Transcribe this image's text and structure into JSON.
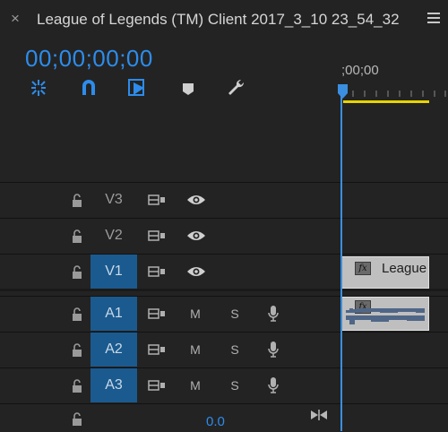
{
  "window": {
    "close_glyph": "×",
    "title": "League of Legends (TM) Client 2017_3_10 23_54_32",
    "menu_icon": "hamburger-menu-icon"
  },
  "timecode": "00;00;00;00",
  "toolbar": {
    "tools": [
      "snap-icon",
      "linked-selection-icon",
      "add-marker-icon",
      "marker-icon",
      "wrench-icon"
    ]
  },
  "ruler": {
    "start_label": ";00;00"
  },
  "tracks": [
    {
      "name": "V3",
      "type": "video",
      "targeted": false
    },
    {
      "name": "V2",
      "type": "video",
      "targeted": false
    },
    {
      "name": "V1",
      "type": "video",
      "targeted": true
    },
    {
      "name": "A1",
      "type": "audio",
      "targeted": true,
      "mute": "M",
      "solo": "S"
    },
    {
      "name": "A2",
      "type": "audio",
      "targeted": true,
      "mute": "M",
      "solo": "S"
    },
    {
      "name": "A3",
      "type": "audio",
      "targeted": true,
      "mute": "M",
      "solo": "S"
    }
  ],
  "clips": {
    "video": {
      "fx": "fx",
      "label": "League"
    },
    "audio": {
      "fx": "fx"
    }
  },
  "master": {
    "volume": "0.0"
  },
  "colors": {
    "accent_blue": "#2d8ceb",
    "target_blue": "#1b5a8e",
    "workarea_yellow": "#e8d400",
    "playhead_blue": "#3a8fe0"
  }
}
